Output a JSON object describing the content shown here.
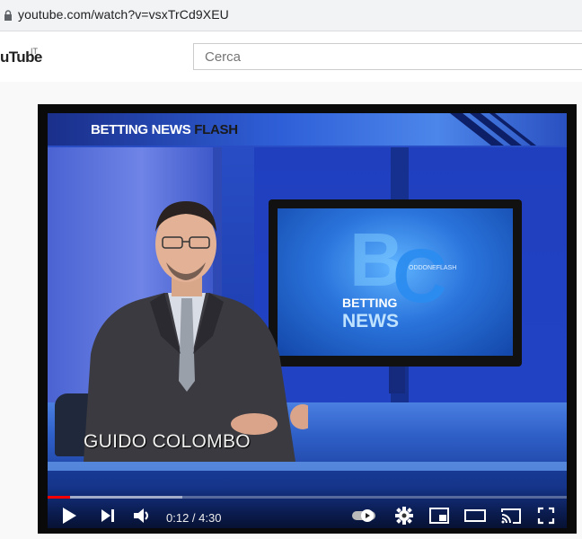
{
  "browser": {
    "url": "youtube.com/watch?v=vsxTrCd9XEU"
  },
  "masthead": {
    "logo_text": "uTube",
    "region": "IT",
    "search_placeholder": "Cerca"
  },
  "video": {
    "banner_part1": "BETTING ",
    "banner_part2": "NEWS ",
    "banner_part3": "FLASH",
    "monitor_text_1": "BETTING",
    "monitor_text_2": "NEWS",
    "monitor_small": "ODDONEFLASH",
    "presenter_name": "GUIDO COLOMBO"
  },
  "player": {
    "current_time": "0:12",
    "separator": " / ",
    "duration": "4:30",
    "progress_played": 0.044,
    "progress_buffered": 0.26
  },
  "colors": {
    "progress": "#ff0000",
    "banner_accent": "#1a1a1a"
  }
}
